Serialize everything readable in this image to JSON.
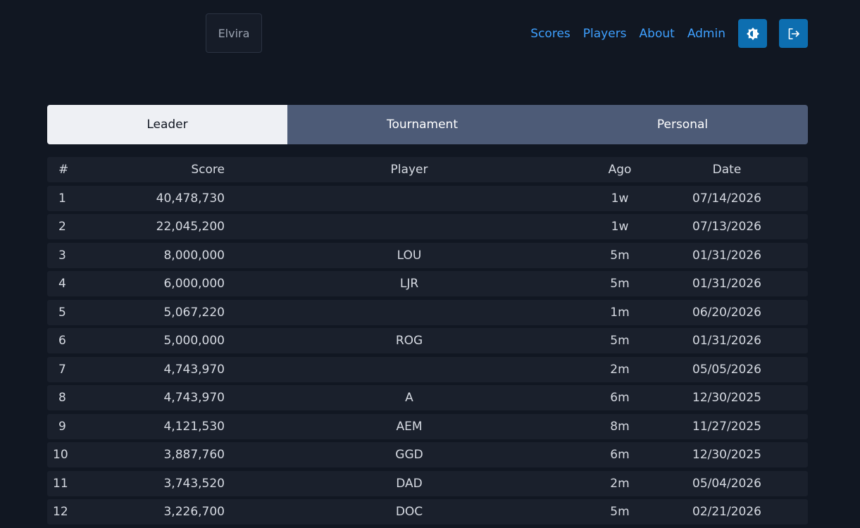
{
  "header": {
    "brand": "Elvira",
    "nav": [
      "Scores",
      "Players",
      "About",
      "Admin"
    ],
    "theme_icon": "brightness-icon",
    "logout_icon": "logout-icon"
  },
  "tabs": [
    "Leader",
    "Tournament",
    "Personal"
  ],
  "active_tab": "Leader",
  "table": {
    "columns": [
      "#",
      "Score",
      "Player",
      "Ago",
      "Date"
    ],
    "rows": [
      {
        "rank": "1",
        "score": "40,478,730",
        "player": "",
        "ago": "1w",
        "date": "07/14/2026"
      },
      {
        "rank": "2",
        "score": "22,045,200",
        "player": "",
        "ago": "1w",
        "date": "07/13/2026"
      },
      {
        "rank": "3",
        "score": "8,000,000",
        "player": "LOU",
        "ago": "5m",
        "date": "01/31/2026"
      },
      {
        "rank": "4",
        "score": "6,000,000",
        "player": "LJR",
        "ago": "5m",
        "date": "01/31/2026"
      },
      {
        "rank": "5",
        "score": "5,067,220",
        "player": "",
        "ago": "1m",
        "date": "06/20/2026"
      },
      {
        "rank": "6",
        "score": "5,000,000",
        "player": "ROG",
        "ago": "5m",
        "date": "01/31/2026"
      },
      {
        "rank": "7",
        "score": "4,743,970",
        "player": "",
        "ago": "2m",
        "date": "05/05/2026"
      },
      {
        "rank": "8",
        "score": "4,743,970",
        "player": "A",
        "ago": "6m",
        "date": "12/30/2025"
      },
      {
        "rank": "9",
        "score": "4,121,530",
        "player": "AEM",
        "ago": "8m",
        "date": "11/27/2025"
      },
      {
        "rank": "10",
        "score": "3,887,760",
        "player": "GGD",
        "ago": "6m",
        "date": "12/30/2025"
      },
      {
        "rank": "11",
        "score": "3,743,520",
        "player": "DAD",
        "ago": "2m",
        "date": "05/04/2026"
      },
      {
        "rank": "12",
        "score": "3,226,700",
        "player": "DOC",
        "ago": "5m",
        "date": "02/21/2026"
      }
    ]
  }
}
